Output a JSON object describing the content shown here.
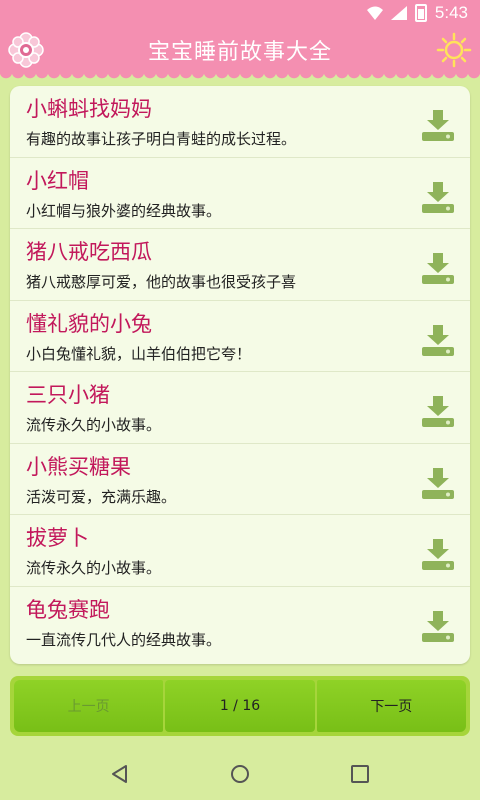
{
  "status_bar": {
    "time": "5:43"
  },
  "header": {
    "title": "宝宝睡前故事大全"
  },
  "stories": [
    {
      "title": "小蝌蚪找妈妈",
      "desc": "有趣的故事让孩子明白青蛙的成长过程。"
    },
    {
      "title": "小红帽",
      "desc": "小红帽与狼外婆的经典故事。"
    },
    {
      "title": "猪八戒吃西瓜",
      "desc": "猪八戒憨厚可爱，他的故事也很受孩子喜"
    },
    {
      "title": "懂礼貌的小兔",
      "desc": "小白兔懂礼貌，山羊伯伯把它夸！"
    },
    {
      "title": "三只小猪",
      "desc": "流传永久的小故事。"
    },
    {
      "title": "小熊买糖果",
      "desc": "活泼可爱，充满乐趣。"
    },
    {
      "title": "拔萝卜",
      "desc": "流传永久的小故事。"
    },
    {
      "title": "龟兔赛跑",
      "desc": "一直流传几代人的经典故事。"
    }
  ],
  "pager": {
    "prev": "上一页",
    "page": "1 / 16",
    "next": "下一页"
  },
  "icons": {
    "logo": "flower-logo-icon",
    "sun": "sun-icon",
    "download": "download-icon",
    "nav": [
      "back-icon",
      "home-icon",
      "recents-icon"
    ]
  },
  "colors": {
    "header": "#f48fb1",
    "background": "#d7ec9e",
    "title_text": "#c2185b",
    "pager_green": "#8fd226"
  }
}
